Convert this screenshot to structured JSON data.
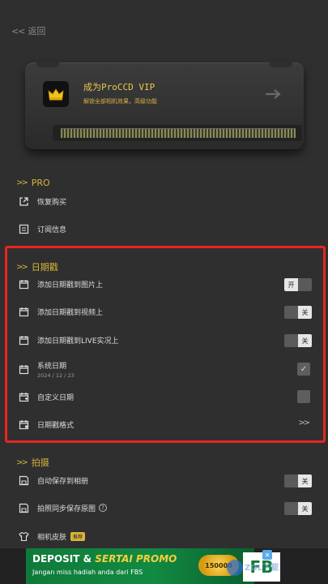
{
  "header": {
    "back_label": "返回"
  },
  "vip": {
    "title": "成为ProCCD VIP",
    "subtitle": "解锁全部相机效果，高级功能"
  },
  "sections": {
    "pro": {
      "title": "PRO",
      "restore_label": "恢复购买",
      "subscription_label": "订阅信息"
    },
    "date": {
      "title": "日期戳",
      "photo_label": "添加日期戳到图片上",
      "photo_toggle": "on",
      "video_label": "添加日期戳到视频上",
      "video_toggle": "off",
      "live_label": "添加日期戳到LIVE实况上",
      "live_toggle": "off",
      "system_label": "系统日期",
      "system_value": "2024 / 12 / 23",
      "system_checked": true,
      "custom_label": "自定义日期",
      "custom_checked": false,
      "format_label": "日期戳格式"
    },
    "shoot": {
      "title": "拍摄",
      "autosave_label": "自动保存到相册",
      "autosave_toggle": "off",
      "original_label": "拍照同步保存原图",
      "original_toggle": "off",
      "skin_label": "相机皮肤",
      "skin_badge": "推荐"
    }
  },
  "toggle_text": {
    "on": "开",
    "off": "关"
  },
  "ad": {
    "title_a": "DEPOSIT & ",
    "title_b": "SERTAI PROMO",
    "subtitle": "Jangan miss hadiah anda dari FBS",
    "badge": "150000",
    "logo": "FB"
  },
  "watermark": "ZOL下载",
  "colors": {
    "accent": "#d9b43a",
    "highlight": "#e8251f",
    "background": "#2f2f2f"
  }
}
